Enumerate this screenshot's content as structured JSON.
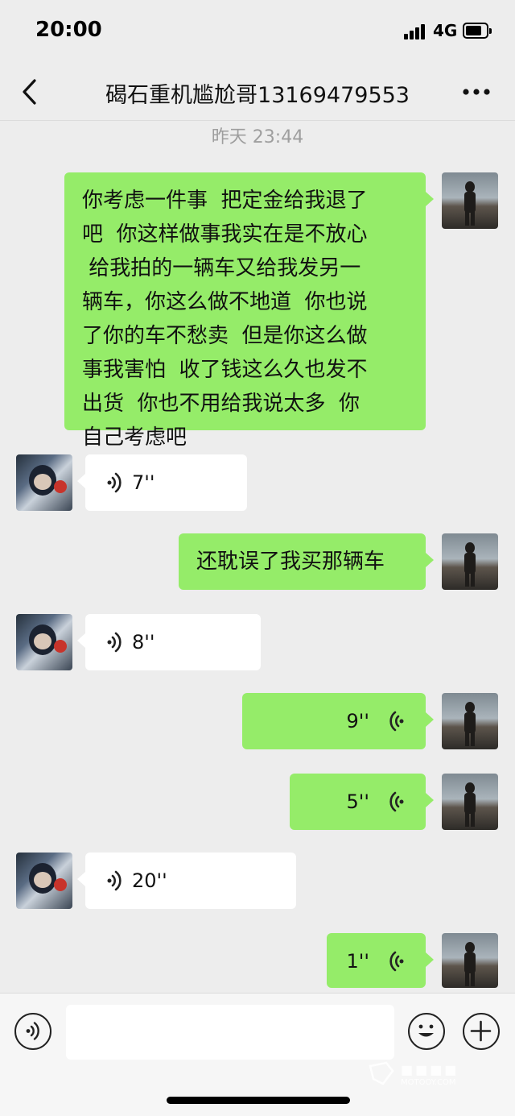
{
  "status_bar": {
    "time": "20:00",
    "network": "4G"
  },
  "header": {
    "title": "碣石重机尴尬哥13169479553"
  },
  "timestamp": "昨天 23:44",
  "messages": [
    {
      "sender": "self",
      "type": "text",
      "lines": [
        "你考虑一件事  把定金给我退了",
        "吧  你这样做事我实在是不放心",
        " 给我拍的一辆车又给我发另一",
        "辆车，你这么做不地道  你也说",
        "了你的车不愁卖  但是你这么做",
        "事我害怕  收了钱这么久也发不",
        "出货  你也不用给我说太多  你",
        "自己考虑吧"
      ]
    },
    {
      "sender": "peer",
      "type": "voice",
      "duration": "7''"
    },
    {
      "sender": "self",
      "type": "text",
      "lines": [
        "还耽误了我买那辆车"
      ]
    },
    {
      "sender": "peer",
      "type": "voice",
      "duration": "8''"
    },
    {
      "sender": "self",
      "type": "voice",
      "duration": "9''"
    },
    {
      "sender": "self",
      "type": "voice",
      "duration": "5''"
    },
    {
      "sender": "peer",
      "type": "voice",
      "duration": "20''"
    },
    {
      "sender": "self",
      "type": "voice",
      "duration": "1''"
    }
  ],
  "input": {
    "value": ""
  },
  "watermark": "MOTOOY.COM",
  "colors": {
    "self_bubble": "#95ec69",
    "peer_bubble": "#ffffff",
    "background": "#ededed"
  },
  "icons": [
    "back-icon",
    "more-icon",
    "voice-icon",
    "emoji-icon",
    "plus-icon"
  ]
}
